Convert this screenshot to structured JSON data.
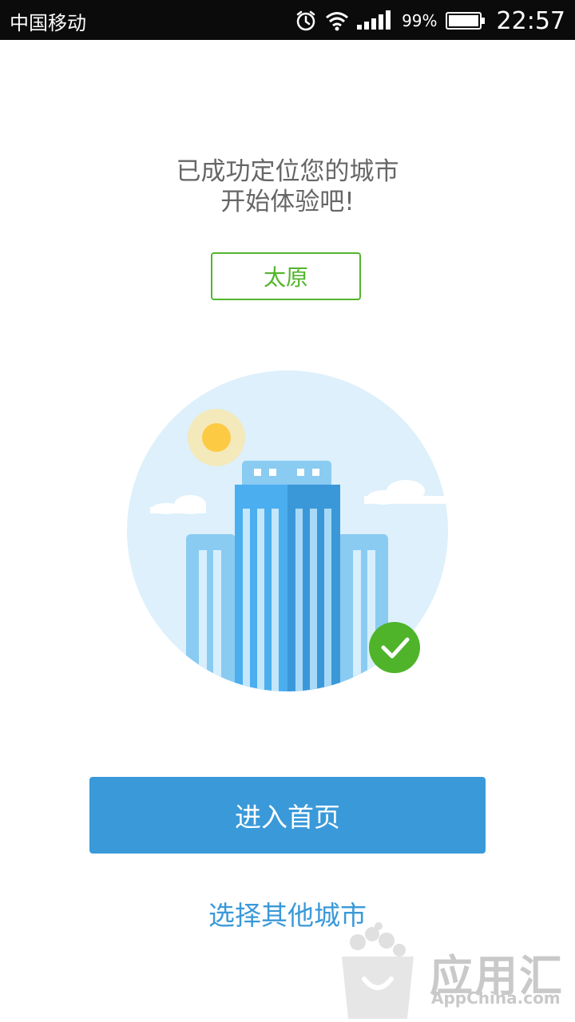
{
  "status_bar": {
    "carrier": "中国移动",
    "battery_percent": "99%",
    "time": "22:57",
    "icons": [
      "alarm-icon",
      "wifi-icon",
      "signal-icon",
      "battery-icon"
    ]
  },
  "headline": {
    "line1": "已成功定位您的城市",
    "line2": "开始体验吧!"
  },
  "city": {
    "name": "太原"
  },
  "actions": {
    "enter_label": "进入首页",
    "other_city_label": "选择其他城市"
  },
  "watermark": {
    "title": "应用汇",
    "domain": "AppChina.com"
  },
  "colors": {
    "accent_blue": "#3a99d9",
    "accent_green": "#53b52d",
    "status_bar": "#0b0b0b"
  }
}
